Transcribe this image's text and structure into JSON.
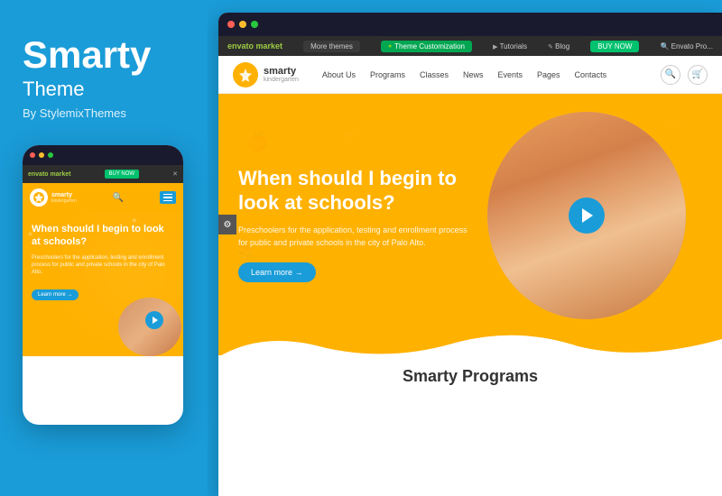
{
  "brand": {
    "title": "Smarty",
    "subtitle": "Theme",
    "author": "By StylemixThemes"
  },
  "mobile": {
    "nav": {
      "logo_text": "smarty",
      "logo_sub": "kindergarten"
    },
    "hero": {
      "title": "When should I begin to look at schools?",
      "description": "Preschoolers for the application, testing and enrollment process for public and private schools in the city of Palo Alto.",
      "learn_more": "Learn more →"
    }
  },
  "desktop": {
    "topbar": {
      "envato": "envato market",
      "more_themes": "More themes",
      "theme_customization": "Theme Customization",
      "tutorials": "Tutorials",
      "blog": "Blog",
      "buy_now": "BUY NOW",
      "search_placeholder": "Envato Pro..."
    },
    "nav": {
      "logo_text": "smarty",
      "logo_sub": "kindergarten",
      "links": [
        "About Us",
        "Programs",
        "Classes",
        "News",
        "Events",
        "Pages",
        "Contacts"
      ]
    },
    "hero": {
      "title": "When should I begin to look at schools?",
      "description": "Preschoolers for the application, testing and enrollment process for public and private schools in the city of Palo Alto.",
      "learn_more": "Learn more →"
    },
    "programs": {
      "title": "Smarty Programs"
    }
  },
  "colors": {
    "orange": "#ffb100",
    "blue": "#1a9cd8",
    "dark": "#1a1a2e",
    "green": "#00c16e"
  },
  "dots": {
    "red": "#ff5f57",
    "yellow": "#febc2e",
    "green": "#28c840"
  }
}
